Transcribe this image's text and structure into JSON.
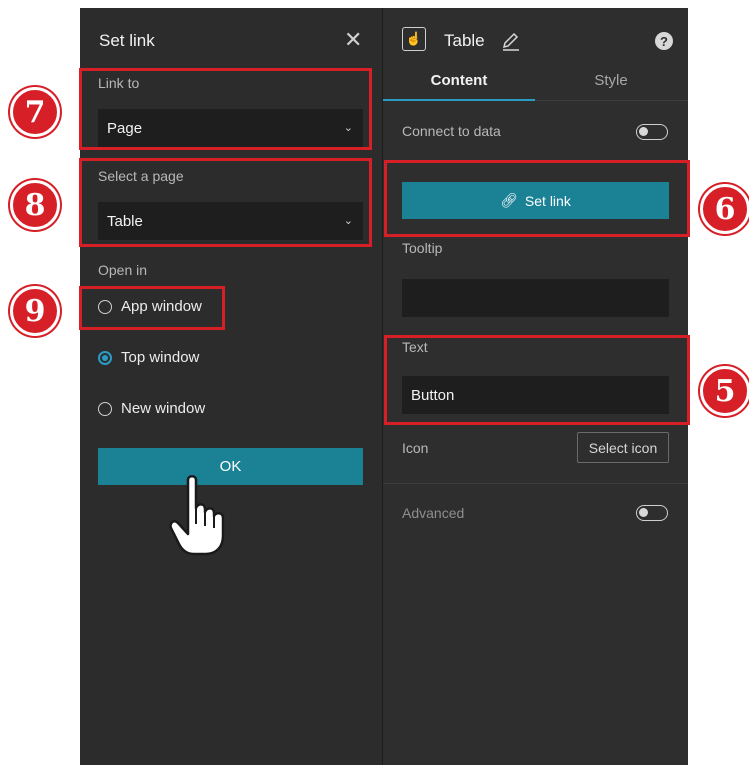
{
  "left_panel": {
    "title": "Set link",
    "link_to": {
      "label": "Link to",
      "value": "Page"
    },
    "select_page": {
      "label": "Select a page",
      "value": "Table"
    },
    "open_in": {
      "label": "Open in",
      "options": [
        {
          "label": "App window",
          "selected": false
        },
        {
          "label": "Top window",
          "selected": true
        },
        {
          "label": "New window",
          "selected": false
        }
      ]
    },
    "ok_label": "OK"
  },
  "right_panel": {
    "title": "Table",
    "tabs": [
      {
        "label": "Content",
        "active": true
      },
      {
        "label": "Style",
        "active": false
      }
    ],
    "connect_to_data": {
      "label": "Connect to data",
      "on": false
    },
    "set_link_label": "Set link",
    "tooltip": {
      "label": "Tooltip",
      "value": ""
    },
    "text": {
      "label": "Text",
      "value": "Button"
    },
    "icon": {
      "label": "Icon",
      "button_label": "Select icon"
    },
    "advanced": {
      "label": "Advanced",
      "on": false
    }
  },
  "annotations": [
    "7",
    "8",
    "9",
    "6",
    "5"
  ],
  "colors": {
    "accent": "#1b8296",
    "highlight": "#d61f26",
    "panel": "#2c2c2c"
  }
}
